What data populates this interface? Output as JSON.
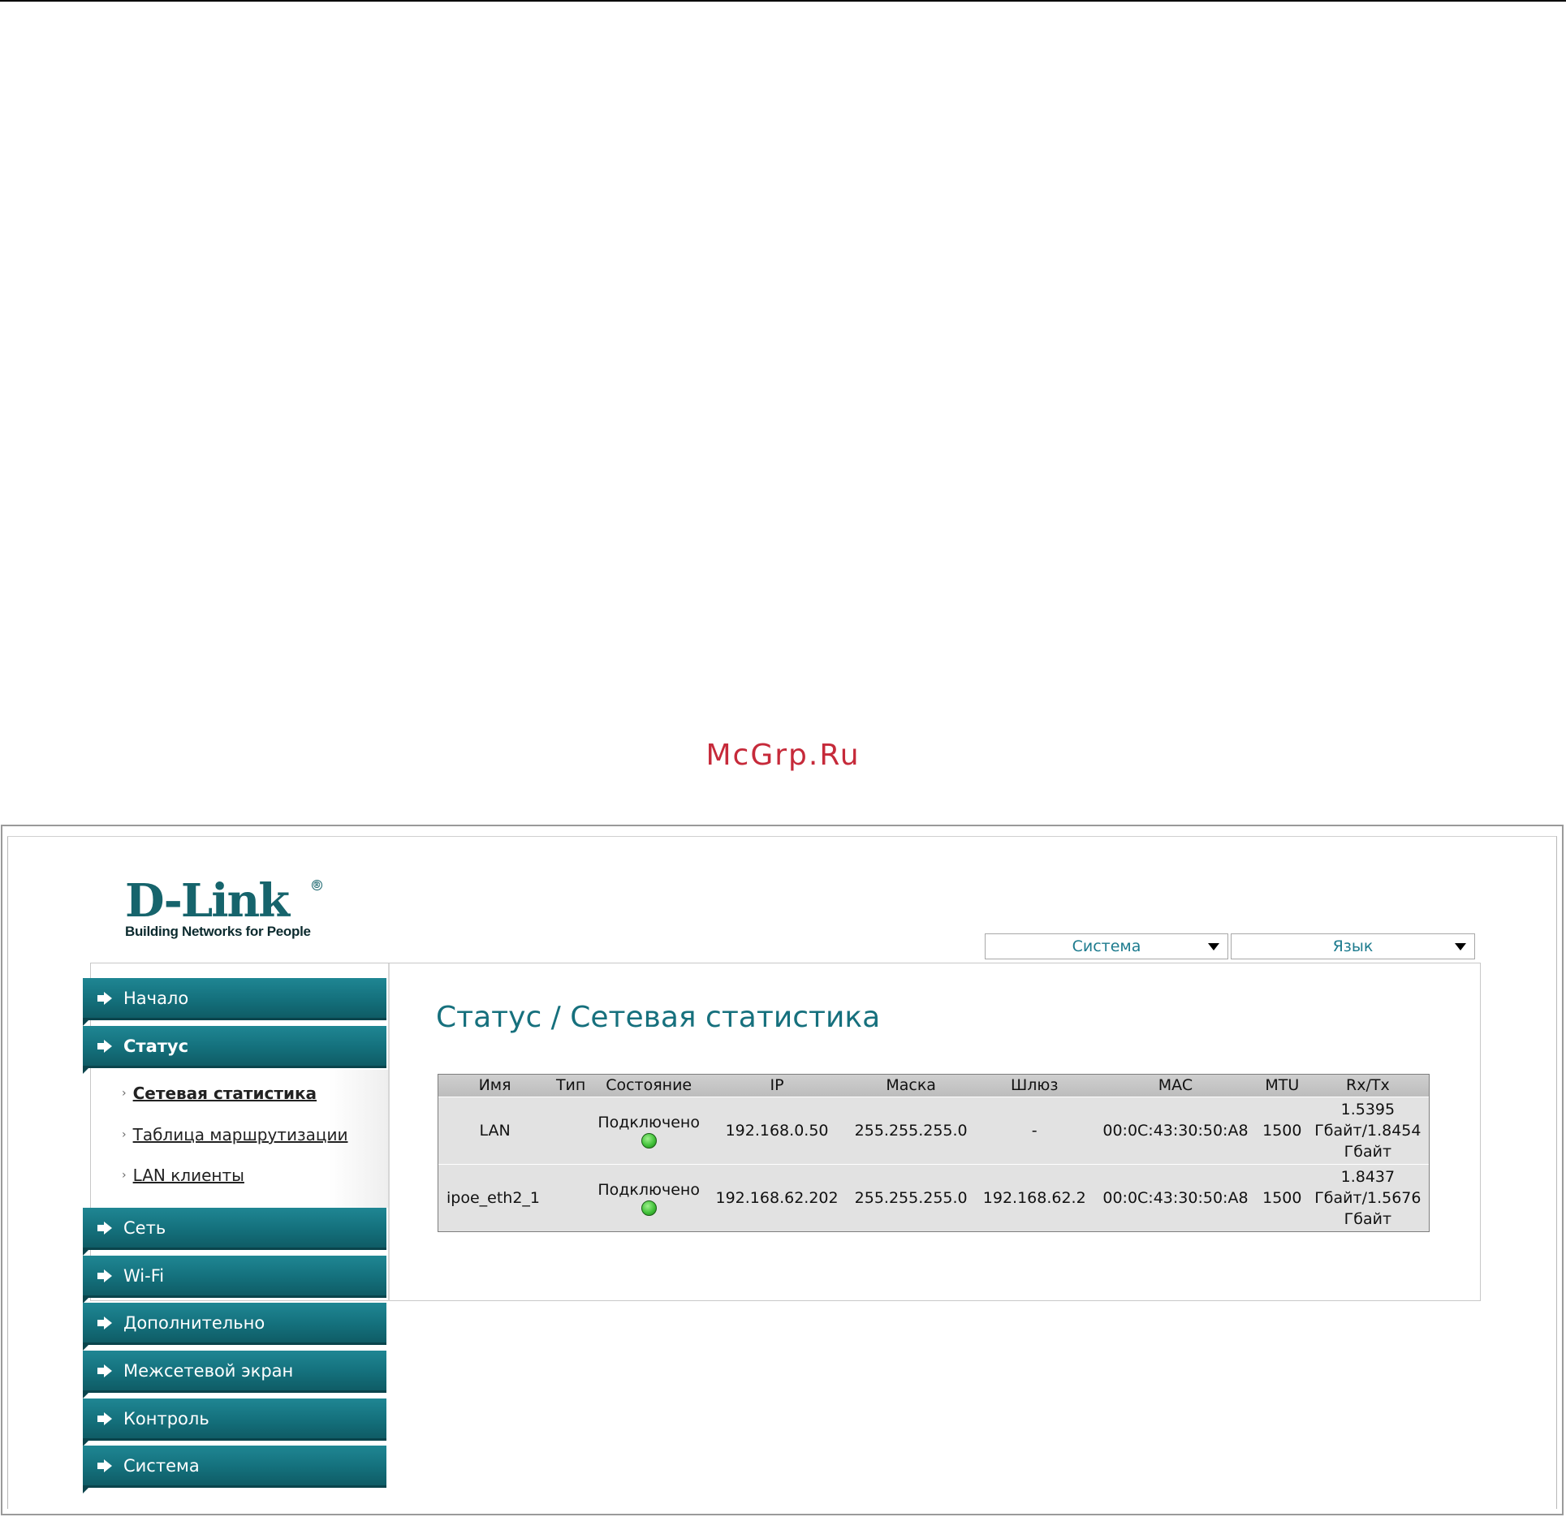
{
  "watermark": "McGrp.Ru",
  "logo": {
    "brand": "D-Link",
    "registered": "®",
    "tagline": "Building Networks for People"
  },
  "header_dropdowns": {
    "system": "Система",
    "language": "Язык"
  },
  "sidebar": {
    "items": [
      {
        "label": "Начало"
      },
      {
        "label": "Статус"
      },
      {
        "label": "Сеть"
      },
      {
        "label": "Wi-Fi"
      },
      {
        "label": "Дополнительно"
      },
      {
        "label": "Межсетевой экран"
      },
      {
        "label": "Контроль"
      },
      {
        "label": "Система"
      }
    ],
    "status_subitems": [
      {
        "label": "Сетевая статистика"
      },
      {
        "label": "Таблица маршрутизации"
      },
      {
        "label": "LAN клиенты"
      }
    ],
    "sub_bullet": "›"
  },
  "main": {
    "title": "Статус / Сетевая статистика",
    "table": {
      "headers": [
        "Имя",
        "Тип",
        "Состояние",
        "IP",
        "Маска",
        "Шлюз",
        "MAC",
        "MTU",
        "Rx/Tx"
      ],
      "rows": [
        {
          "name": "LAN",
          "type": "",
          "state": "Подключено",
          "ip": "192.168.0.50",
          "mask": "255.255.255.0",
          "gateway": "-",
          "mac": "00:0C:43:30:50:A8",
          "mtu": "1500",
          "rxtx_1": "1.5395",
          "rxtx_2": "Гбайт/1.8454",
          "rxtx_3": "Гбайт"
        },
        {
          "name": "ipoe_eth2_1",
          "type": "",
          "state": "Подключено",
          "ip": "192.168.62.202",
          "mask": "255.255.255.0",
          "gateway": "192.168.62.2",
          "mac": "00:0C:43:30:50:A8",
          "mtu": "1500",
          "rxtx_1": "1.8437",
          "rxtx_2": "Гбайт/1.5676",
          "rxtx_3": "Гбайт"
        }
      ]
    }
  },
  "colors": {
    "accent": "#14707c",
    "title": "#16707d",
    "watermark": "#c62a3a",
    "status_connected": "#42c23a"
  }
}
